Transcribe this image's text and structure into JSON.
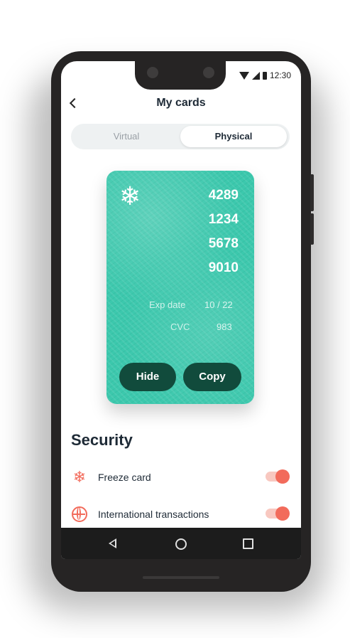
{
  "status_bar": {
    "time": "12:30"
  },
  "header": {
    "title": "My cards",
    "back_icon": "chevron-left-icon"
  },
  "segmented": {
    "tabs": [
      {
        "label": "Virtual",
        "selected": false
      },
      {
        "label": "Physical",
        "selected": true
      }
    ]
  },
  "card": {
    "frozen_icon": "snowflake-icon",
    "number_groups": [
      "4289",
      "1234",
      "5678",
      "9010"
    ],
    "exp_label": "Exp date",
    "exp_value": "10 / 22",
    "cvc_label": "CVC",
    "cvc_value": "983",
    "hide_label": "Hide",
    "copy_label": "Copy",
    "color": "#3cc8ad",
    "button_color": "#114b3c"
  },
  "security": {
    "title": "Security",
    "items": [
      {
        "label": "Freeze card",
        "icon": "snowflake-icon",
        "enabled": true
      },
      {
        "label": "International transactions",
        "icon": "globe-icon",
        "enabled": true
      }
    ],
    "accent": "#f26b5b"
  },
  "nav": {
    "icons": [
      "back-icon",
      "home-icon",
      "recents-icon"
    ]
  }
}
